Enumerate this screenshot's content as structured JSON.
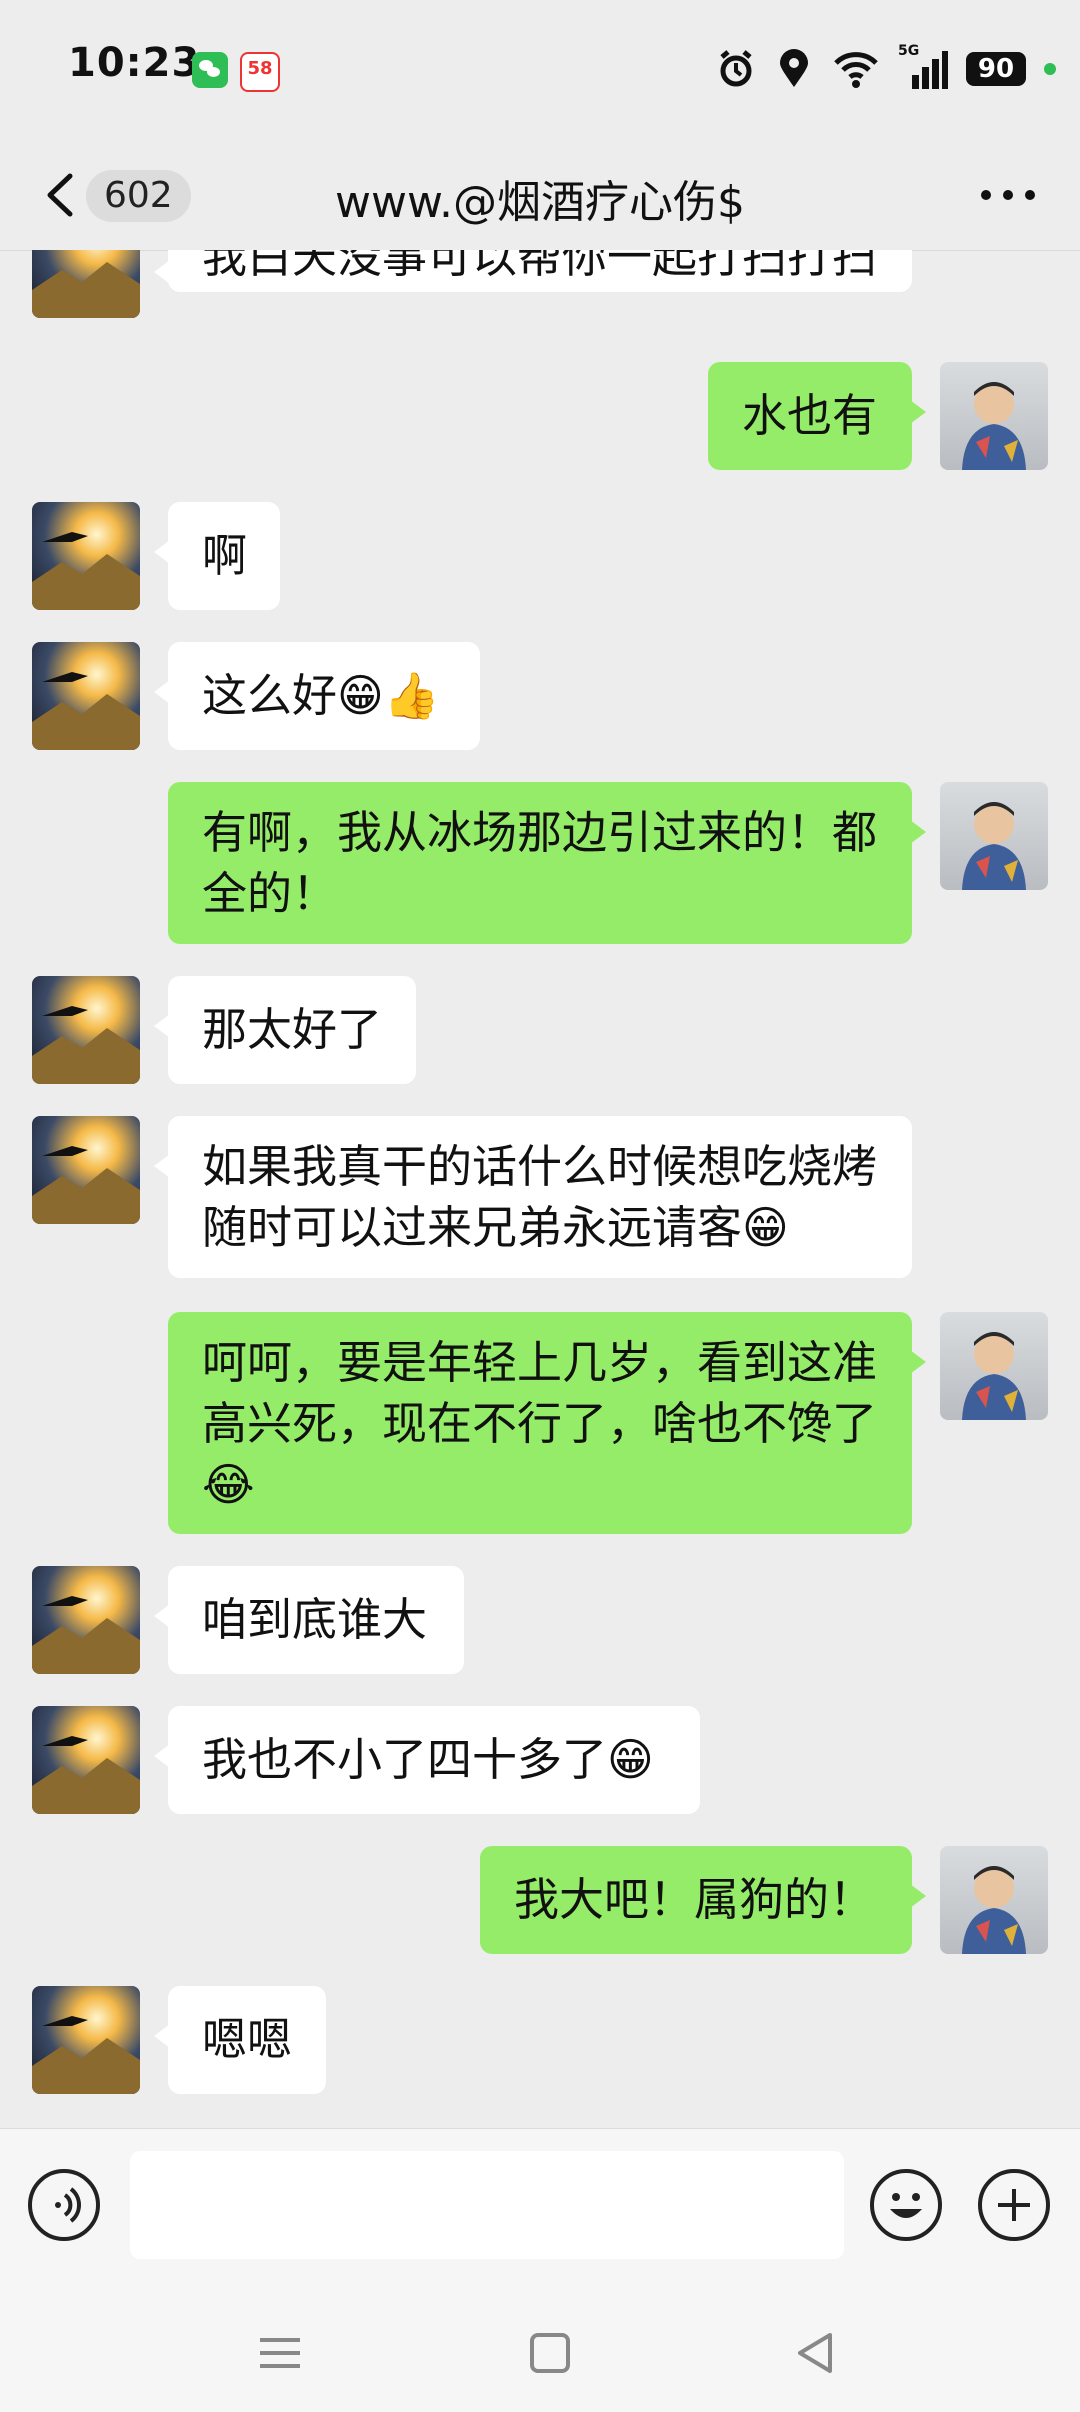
{
  "status_bar": {
    "time": "10:23",
    "app58_label": "58",
    "network": "5G",
    "battery": "90"
  },
  "nav": {
    "unread_count": "602",
    "title": "www.@烟酒疗心伤$"
  },
  "messages": [
    {
      "side": "in",
      "text": "我白天没事可以帮你一起打扫打扫"
    },
    {
      "side": "out",
      "text": "水也有"
    },
    {
      "side": "in",
      "text": "啊"
    },
    {
      "side": "in",
      "text": "这么好😁👍"
    },
    {
      "side": "out",
      "text": "有啊，我从冰场那边引过来的！都全的！"
    },
    {
      "side": "in",
      "text": "那太好了"
    },
    {
      "side": "in",
      "text": "如果我真干的话什么时候想吃烧烤随时可以过来兄弟永远请客😁"
    },
    {
      "side": "out",
      "text": "呵呵，要是年轻上几岁，看到这准高兴死，现在不行了，啥也不馋了😂"
    },
    {
      "side": "in",
      "text": "咱到底谁大"
    },
    {
      "side": "in",
      "text": "我也不小了四十多了😁"
    },
    {
      "side": "out",
      "text": "我大吧！属狗的！"
    },
    {
      "side": "in",
      "text": "嗯嗯"
    }
  ],
  "input": {
    "value": "",
    "placeholder": ""
  },
  "colors": {
    "background": "#ededed",
    "incoming_bubble": "#ffffff",
    "outgoing_bubble": "#95ec69"
  },
  "icons": {
    "back": "chevron-left-icon",
    "more": "more-dots-icon",
    "voice": "voice-icon",
    "emoji": "emoji-icon",
    "plus": "plus-icon"
  }
}
